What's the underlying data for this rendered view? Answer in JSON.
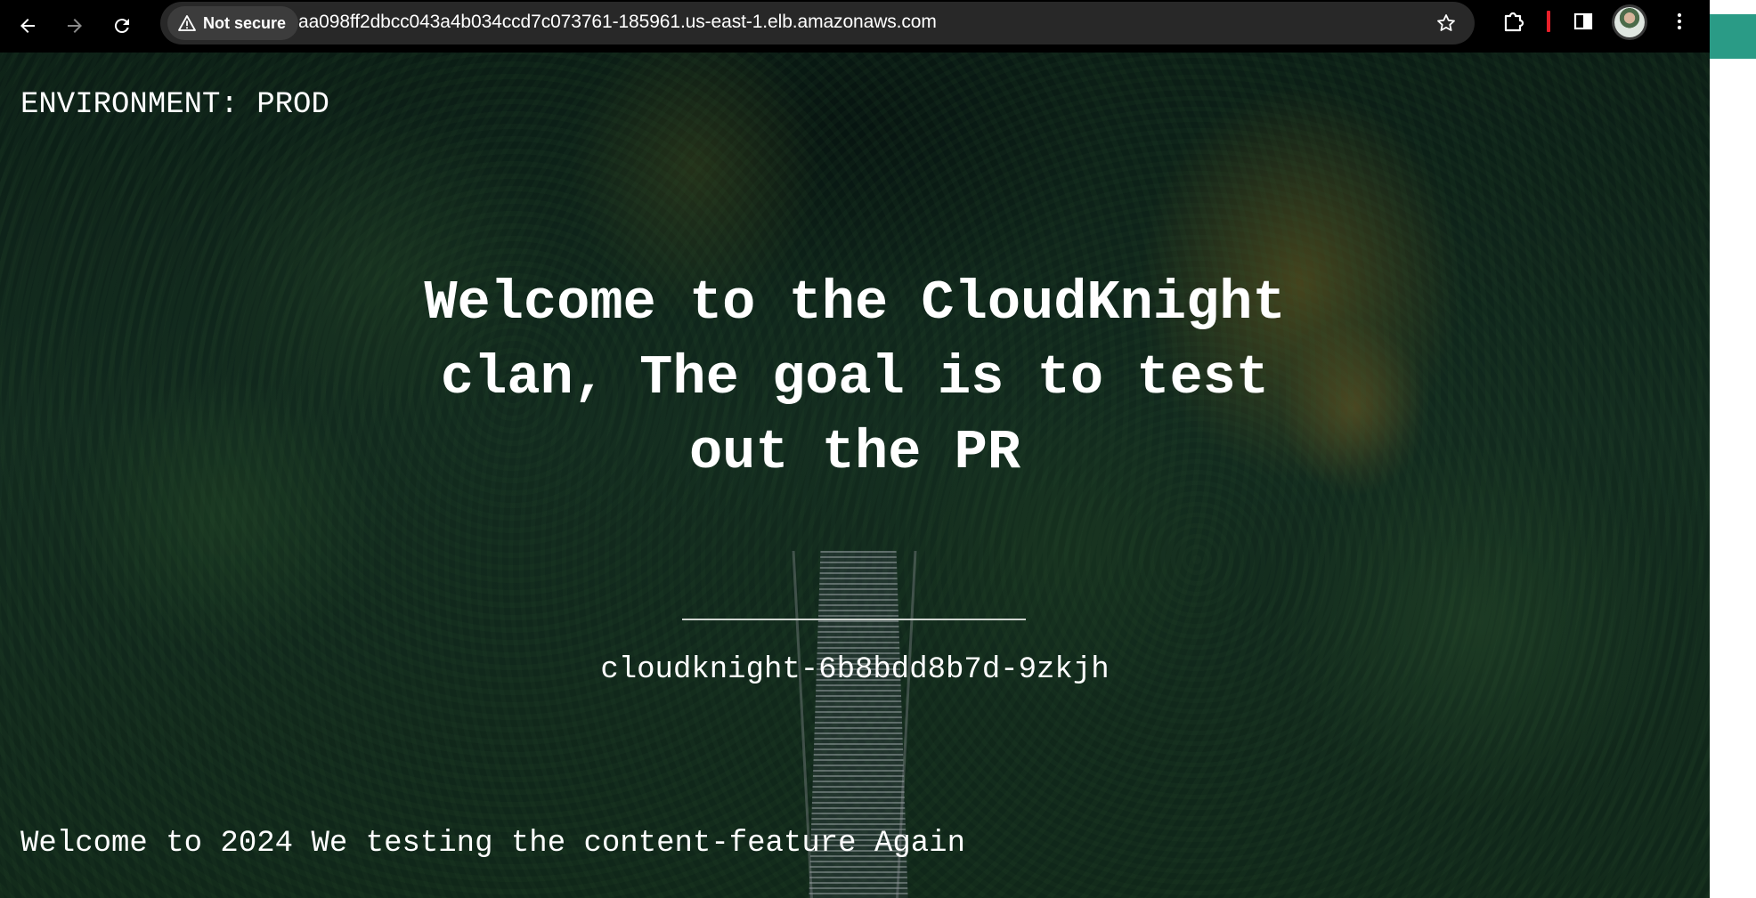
{
  "browser": {
    "security_label": "Not secure",
    "url": "aa098ff2dbcc043a4b034ccd7c073761-185961.us-east-1.elb.amazonaws.com",
    "icons": [
      "back-arrow-icon",
      "forward-arrow-icon",
      "reload-icon",
      "warning-icon",
      "star-icon",
      "extensions-icon",
      "side-panel-icon",
      "profile-avatar",
      "more-vert-icon"
    ]
  },
  "page": {
    "environment": "ENVIRONMENT: PROD",
    "headline": "Welcome to the CloudKnight clan, The goal is to test out the PR",
    "pod_name": "cloudknight-6b8bdd8b7d-9zkjh",
    "footer": "Welcome to 2024 We testing the content-feature Again"
  },
  "colors": {
    "chrome_bg": "#000000",
    "omnibox_bg": "#282828",
    "accent_teal": "#2a9b86",
    "text": "#ffffff"
  }
}
